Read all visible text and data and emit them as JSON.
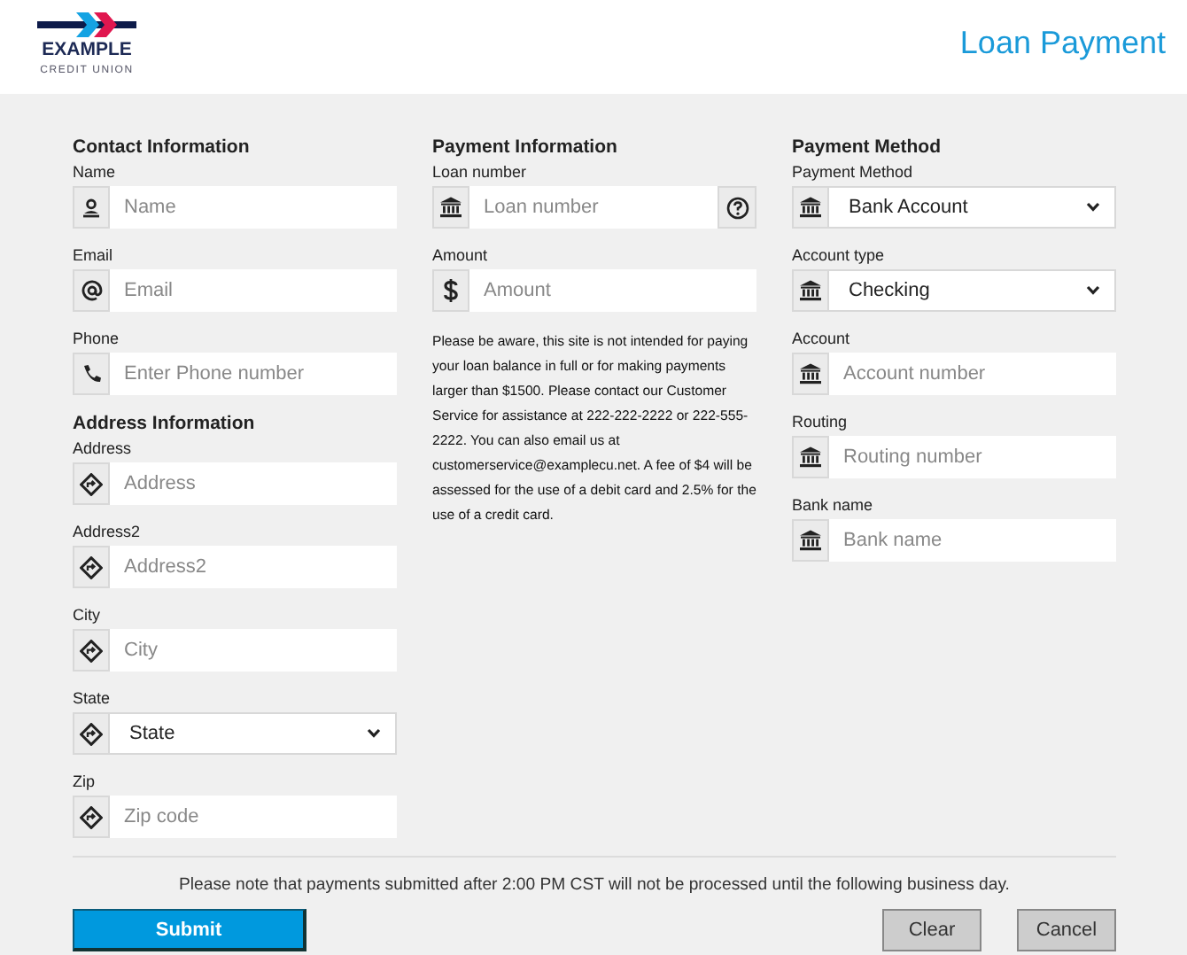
{
  "header": {
    "logo_name": "EXAMPLE",
    "logo_subtitle": "CREDIT UNION",
    "title": "Loan Payment"
  },
  "columns": [
    {
      "sections": [
        {
          "heading": "Contact Information",
          "fields": [
            {
              "label": "Name",
              "kind": "text",
              "placeholder": "Name"
            },
            {
              "label": "Email",
              "kind": "text",
              "placeholder": "Email"
            },
            {
              "label": "Phone",
              "kind": "text",
              "placeholder": "Enter Phone number"
            }
          ]
        },
        {
          "heading": "Address Information",
          "fields": [
            {
              "label": "Address",
              "kind": "text",
              "placeholder": "Address"
            },
            {
              "label": "Address2",
              "kind": "text",
              "placeholder": "Address2"
            },
            {
              "label": "City",
              "kind": "text",
              "placeholder": "City"
            },
            {
              "label": "State",
              "kind": "select",
              "value": "State"
            },
            {
              "label": "Zip",
              "kind": "text",
              "placeholder": "Zip code"
            }
          ]
        }
      ]
    },
    {
      "sections": [
        {
          "heading": "Payment Information",
          "fields": [
            {
              "label": "Loan number",
              "kind": "text",
              "placeholder": "Loan number",
              "help": true
            },
            {
              "label": "Amount",
              "kind": "text",
              "placeholder": "Amount"
            }
          ],
          "note": "Please be aware, this site is not intended for paying your loan balance in full or for making payments larger than $1500. Please contact our Customer Service for assistance at 222-222-2222 or 222-555-2222. You can also email us at customerservice@examplecu.net. A fee of $4 will be assessed for the use of a debit card and 2.5% for the use of a credit card."
        }
      ]
    },
    {
      "sections": [
        {
          "heading": "Payment Method",
          "fields": [
            {
              "label": "Payment Method",
              "kind": "select",
              "value": "Bank Account"
            },
            {
              "label": "Account type",
              "kind": "select",
              "value": "Checking"
            },
            {
              "label": "Account",
              "kind": "text",
              "placeholder": "Account number"
            },
            {
              "label": "Routing",
              "kind": "text",
              "placeholder": "Routing number"
            },
            {
              "label": "Bank name",
              "kind": "text",
              "placeholder": "Bank name"
            }
          ]
        }
      ]
    }
  ],
  "footer_note": "Please note that payments submitted after 2:00 PM CST will not be processed until the following business day.",
  "buttons": [
    {
      "label": "Submit",
      "kind": "primary"
    },
    {
      "label": "Clear",
      "kind": "secondary"
    },
    {
      "label": "Cancel",
      "kind": "secondary"
    }
  ]
}
